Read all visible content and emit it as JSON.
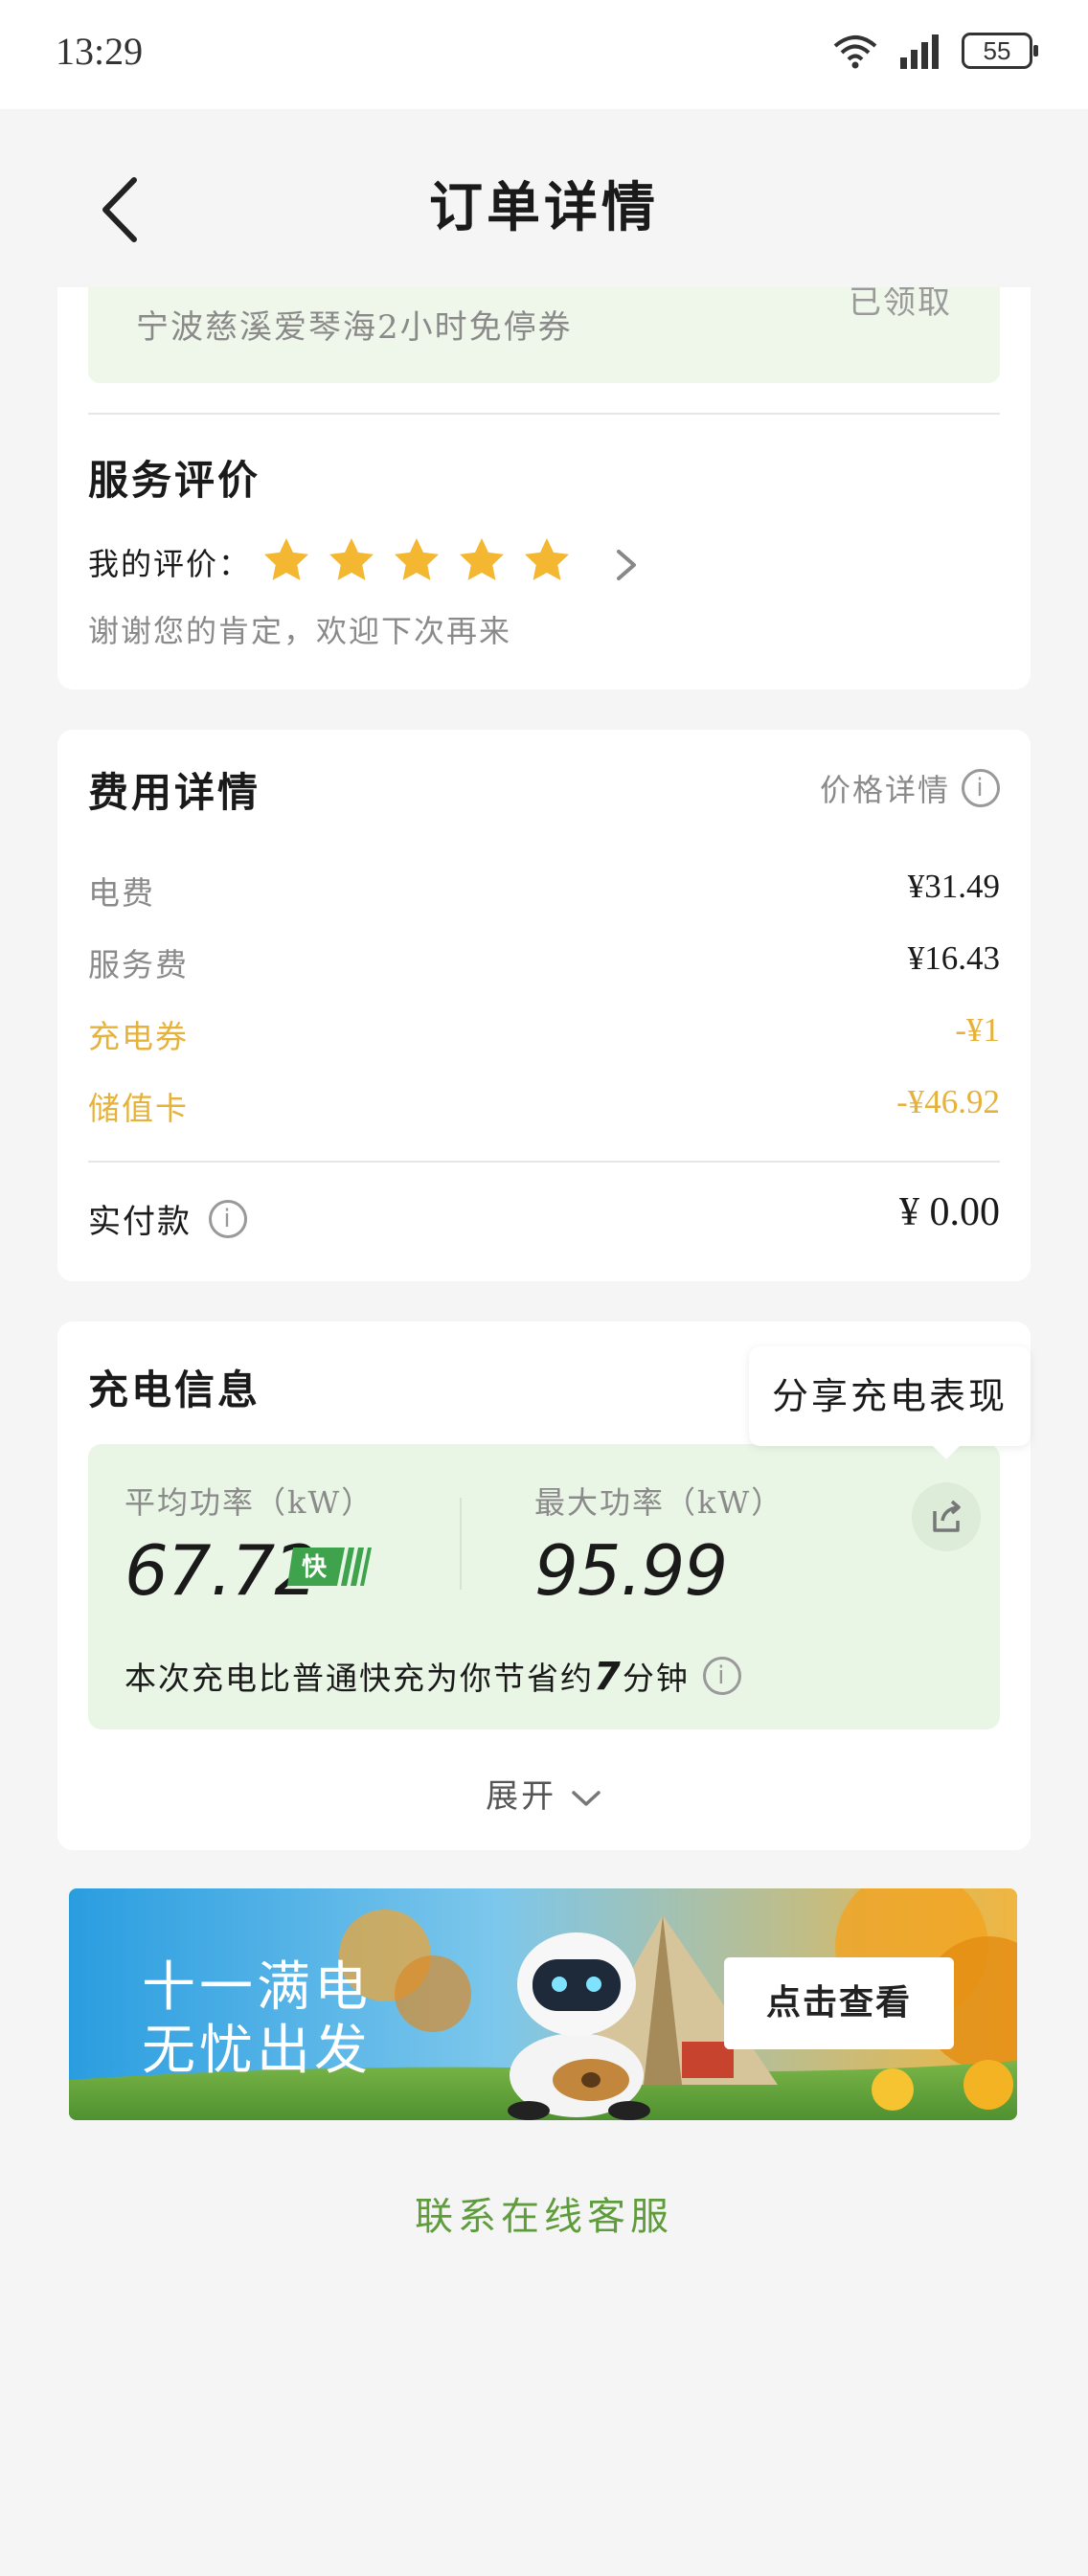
{
  "status_bar": {
    "time": "13:29",
    "battery": "55"
  },
  "header": {
    "title": "订单详情"
  },
  "coupon": {
    "name": "宁波慈溪爱琴海2小时免停券",
    "status": "已领取"
  },
  "review": {
    "title": "服务评价",
    "label": "我的评价：",
    "stars": 5,
    "message": "谢谢您的肯定，欢迎下次再来"
  },
  "fees": {
    "title": "费用详情",
    "price_detail_link": "价格详情",
    "rows": [
      {
        "label": "电费",
        "value": "¥31.49"
      },
      {
        "label": "服务费",
        "value": "¥16.43"
      },
      {
        "label": "充电券",
        "value": "-¥1"
      },
      {
        "label": "储值卡",
        "value": "-¥46.92"
      }
    ],
    "paid_label": "实付款",
    "paid_value": "¥ 0.00"
  },
  "charging": {
    "title": "充电信息",
    "share_tooltip": "分享充电表现",
    "avg_power_label": "平均功率（kW）",
    "avg_power_value": "67.72",
    "fast_badge": "快",
    "max_power_label": "最大功率（kW）",
    "max_power_value": "95.99",
    "saving_prefix": "本次充电比普通快充为你节省约",
    "saving_minutes": "7",
    "saving_suffix": "分钟",
    "expand_label": "展开"
  },
  "banner": {
    "line1": "十一满电",
    "line2": "无忧出发",
    "button": "点击查看"
  },
  "footer": {
    "contact_label": "联系在线客服"
  },
  "colors": {
    "accent_green": "#5e9c3c",
    "gold": "#e6b23a",
    "star": "#f3b731",
    "fast_badge": "#3fa34d"
  }
}
